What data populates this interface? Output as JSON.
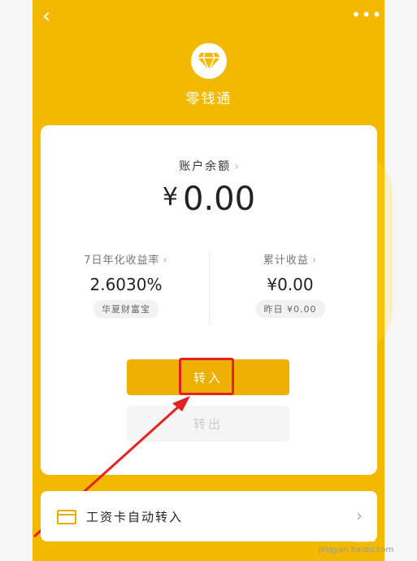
{
  "header": {
    "back_icon": "back-chevron-icon",
    "more_icon": "more-dots-icon",
    "app_title": "零钱通"
  },
  "account": {
    "balance_label": "账户余额",
    "currency": "¥",
    "balance_value": "0.00"
  },
  "yield": {
    "label": "7日年化收益率",
    "value": "2.6030%",
    "fund": "华夏财富宝"
  },
  "earnings": {
    "label": "累计收益",
    "value": "¥0.00",
    "yesterday": "昨日 ¥0.00"
  },
  "actions": {
    "transfer_in": "转入",
    "transfer_out": "转出"
  },
  "salary": {
    "label": "工资卡自动转入"
  },
  "watermark": {
    "text": "Bai 经验",
    "sub": "jingyan.baidu.com"
  },
  "colors": {
    "brand_yellow": "#f3b800",
    "button_yellow": "#eeb000",
    "highlight_red": "#e52222"
  }
}
